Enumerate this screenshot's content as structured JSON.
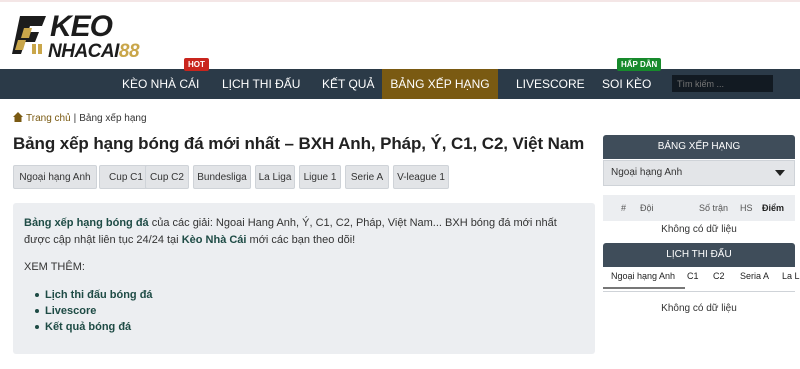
{
  "logo": {
    "line1": "KEO",
    "line2_main": "NHACAI",
    "line2_accent": "88",
    "mark_color": "#c9a64a"
  },
  "colors": {
    "nav_bg": "#2b3a48",
    "nav_active_bg": "#7a5a12",
    "accent_green": "#1e4b45",
    "badge_hot": "#c9251d",
    "badge_hap": "#178a2c"
  },
  "nav": {
    "items": [
      {
        "label": "KÈO NHÀ CÁI"
      },
      {
        "label": "LỊCH THI ĐẤU"
      },
      {
        "label": "KẾT QUẢ"
      },
      {
        "label": "BẢNG XẾP HẠNG",
        "active": true
      },
      {
        "label": "LIVESCORE"
      },
      {
        "label": "SOI KÈO"
      }
    ],
    "badge_hot": "HOT",
    "badge_hap": "HẤP DẪN",
    "search_placeholder": "Tìm kiếm ..."
  },
  "breadcrumb": {
    "home": "Trang chủ",
    "separator": "|",
    "current": "Bảng xếp hạng"
  },
  "page_title": "Bảng xếp hạng bóng đá mới nhất – BXH Anh, Pháp, Ý, C1, C2, Việt Nam",
  "league_tabs": [
    "Ngoại hạng Anh",
    "Cup C1",
    "Cup C2",
    "Bundesliga",
    "La Liga",
    "Ligue 1",
    "Serie A",
    "V-league 1"
  ],
  "info": {
    "lead_bold": "Bảng xếp hạng bóng đá",
    "text1": " của các giải: Ngoai Hang Anh, Ý, C1, C2, Pháp, Việt Nam... BXH bóng đá mới nhất được cập nhật liên tục 24/24 tại ",
    "brand_bold": "Kèo Nhà Cái",
    "text2": " mới các bạn theo dõi!",
    "see_more": "XEM THÊM:",
    "links": [
      "Lịch thi đấu bóng đá",
      "Livescore",
      "Kết quả bóng đá"
    ]
  },
  "sidebar": {
    "standings": {
      "header": "BẢNG XẾP HẠNG",
      "selected": "Ngoại hạng Anh",
      "columns": {
        "rank": "#",
        "team": "Đội",
        "played": "Số trận",
        "gd": "HS",
        "points": "Điểm"
      },
      "empty": "Không có dữ liệu"
    },
    "schedule": {
      "header": "LỊCH THI ĐẤU",
      "tabs": [
        "Ngoại hạng Anh",
        "C1",
        "C2",
        "Seria A",
        "La L"
      ],
      "empty": "Không có dữ liệu"
    }
  }
}
